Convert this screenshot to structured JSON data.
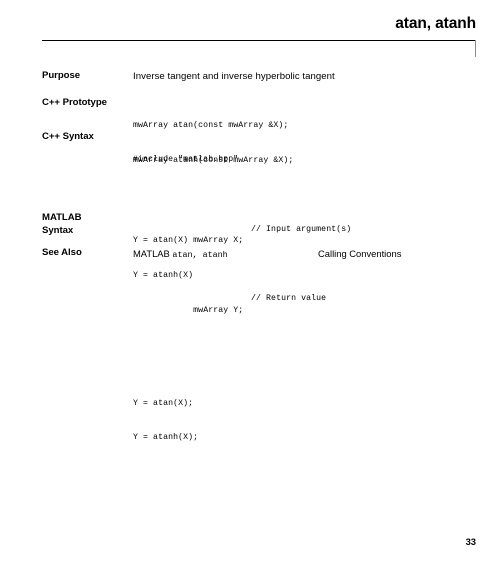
{
  "header": {
    "title": "atan, atanh"
  },
  "rows": [
    {
      "label": "Purpose",
      "text": "Inverse tangent and inverse hyperbolic tangent"
    },
    {
      "label": "C++ Prototype",
      "lines": [
        "mwArray atan(const mwArray &X);",
        "mwArray atanh(const mwArray &X);"
      ]
    },
    {
      "label": "C++ Syntax",
      "include_line": "#include \"matlab.hpp\"",
      "decl_lines": [
        {
          "code": "mwArray X;",
          "comment": "// Input argument(s)"
        },
        {
          "code": "mwArray Y;",
          "comment": "// Return value"
        }
      ],
      "call_lines": [
        "Y = atan(X);",
        "Y = atanh(X);"
      ]
    },
    {
      "label": "MATLAB\nSyntax",
      "lines": [
        "Y = atan(X)",
        "Y = atanh(X)"
      ]
    },
    {
      "label": "See Also",
      "see_also_prefix": "MATLAB ",
      "see_also_functions": "atan, atanh",
      "see_also_link": "Calling Conventions"
    }
  ],
  "footer": {
    "page_number": "33"
  }
}
